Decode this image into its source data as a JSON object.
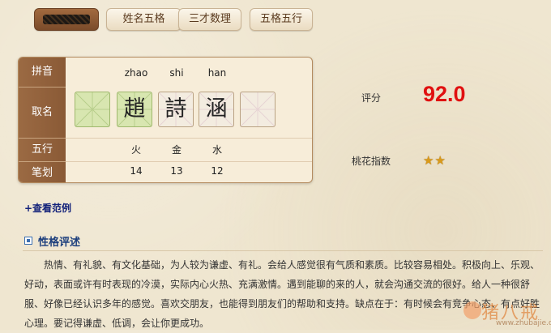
{
  "tabs": [
    {
      "label": "",
      "active": true
    },
    {
      "label": "姓名五格",
      "active": false
    },
    {
      "label": "三才数理",
      "active": false
    },
    {
      "label": "五格五行",
      "active": false
    }
  ],
  "card": {
    "row_labels": [
      "拼音",
      "取名",
      "五行",
      "笔划"
    ],
    "columns": [
      {
        "pinyin": "",
        "char": "",
        "wuxing": "",
        "bihua": ""
      },
      {
        "pinyin": "zhao",
        "char": "趙",
        "wuxing": "火",
        "bihua": "14"
      },
      {
        "pinyin": "shi",
        "char": "詩",
        "wuxing": "金",
        "bihua": "13"
      },
      {
        "pinyin": "han",
        "char": "涵",
        "wuxing": "水",
        "bihua": "12"
      },
      {
        "pinyin": "",
        "char": "",
        "wuxing": "",
        "bihua": ""
      }
    ]
  },
  "score": {
    "label": "评分",
    "value": "92.0",
    "color": "#e01010"
  },
  "peach": {
    "label": "桃花指数",
    "stars": 2,
    "star_icon": "star-icon"
  },
  "example_link": "+查看范例",
  "section": {
    "title": "性格评述",
    "text": "热情、有礼貌、有文化基础，为人较为谦虚、有礼。会给人感觉很有气质和素质。比较容易相处。积极向上、乐观、好动，表面或许有时表现的冷漠，实际内心火热、充满激情。遇到能聊的来的人，就会沟通交流的很好。给人一种很舒服、好像已经认识多年的感觉。喜欢交朋友，也能得到朋友们的帮助和支持。缺点在于：有时候会有竞争心态、有点好胜心理。要记得谦虚、低调，会让你更成功。"
  },
  "watermark": {
    "text": "猪八戒",
    "url": "www.zhubajie.com"
  },
  "colors": {
    "accent_brown": "#8a5a36",
    "link_blue": "#13227a",
    "score_red": "#e01010"
  }
}
